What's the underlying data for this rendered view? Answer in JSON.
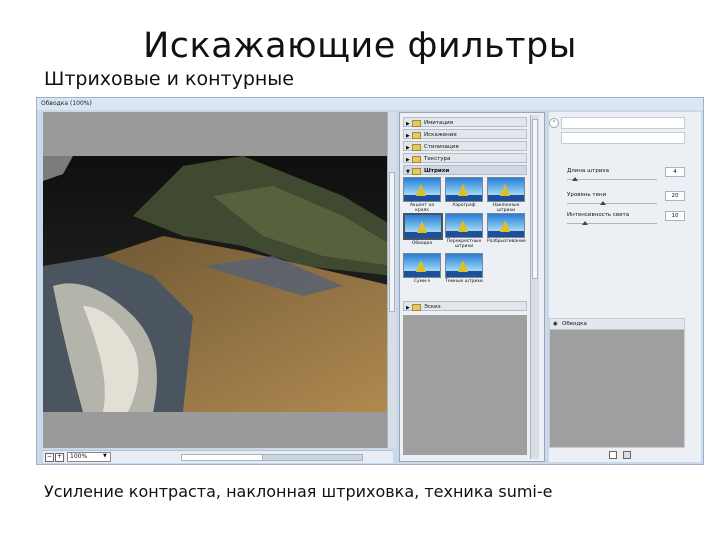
{
  "slide": {
    "title": "Искажающие фильтры",
    "subtitle": "Штриховые и контурные",
    "caption": "Усиление контраста, наклонная штриховка, техника sumi-e"
  },
  "window": {
    "title": "Обводка (100%)",
    "zoom": "100%",
    "zoom_minus": "−",
    "zoom_plus": "+",
    "zoom_dropdown": "▼"
  },
  "gallery": {
    "categories_before": [
      {
        "label": "Имитация",
        "expanded": false
      },
      {
        "label": "Искажение",
        "expanded": false
      },
      {
        "label": "Стилизация",
        "expanded": false
      },
      {
        "label": "Текстура",
        "expanded": false
      }
    ],
    "open_category": {
      "label": "Штрихи",
      "expanded": true
    },
    "filters": [
      {
        "label": "Акцент на краях",
        "selected": false
      },
      {
        "label": "Аэрограф",
        "selected": false
      },
      {
        "label": "Наклонные штрихи",
        "selected": false
      },
      {
        "label": "Обводка",
        "selected": true
      },
      {
        "label": "Перекрестные штрихи",
        "selected": false
      },
      {
        "label": "Разбрызгивание",
        "selected": false
      },
      {
        "label": "Суми-э",
        "selected": false
      },
      {
        "label": "Темные штрихи",
        "selected": false
      }
    ],
    "categories_after": [
      {
        "label": "Эскиз",
        "expanded": false
      }
    ]
  },
  "settings": {
    "collapse_icon": "⌃",
    "params": [
      {
        "label": "Длина штриха",
        "value": "4",
        "fraction": 0.08
      },
      {
        "label": "Уровень тени",
        "value": "20",
        "fraction": 0.4
      },
      {
        "label": "Интенсивность света",
        "value": "10",
        "fraction": 0.2
      }
    ]
  },
  "layers": {
    "active_layer": "Обводка"
  },
  "colors": {
    "window_bg": "#c9d8ea",
    "preview_bg": "#3a3428"
  },
  "icons": {
    "folder": "folder-icon",
    "expand": "triangle-right-icon",
    "collapse": "triangle-down-icon",
    "eye": "eye-icon",
    "new_layer": "new-layer-icon",
    "delete_layer": "trash-icon"
  }
}
